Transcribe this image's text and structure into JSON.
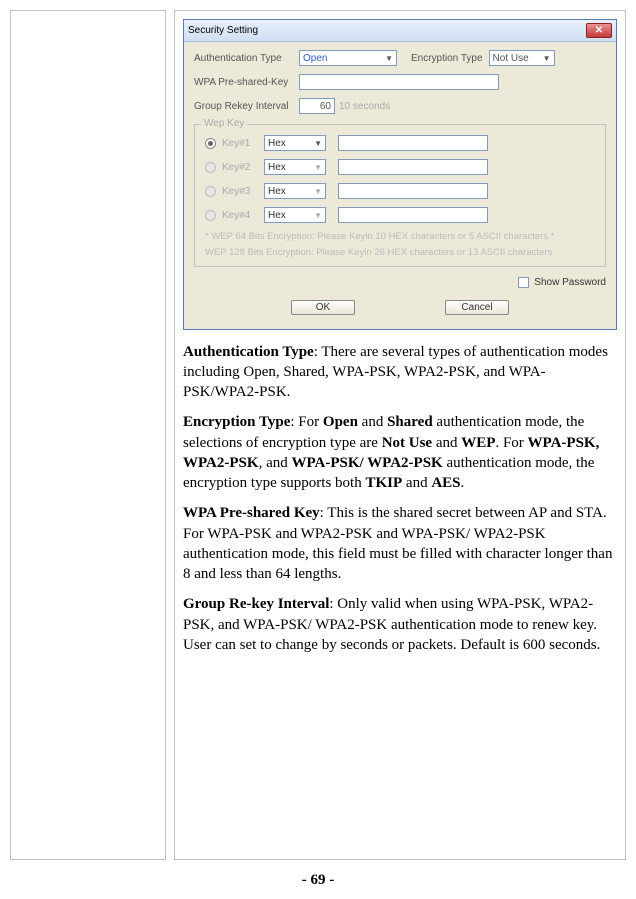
{
  "dialog": {
    "title": "Security Setting",
    "close_glyph": "✕",
    "auth_label": "Authentication Type",
    "auth_value": "Open",
    "enc_label": "Encryption Type",
    "enc_value": "Not Use",
    "psk_label": "WPA Pre-shared-Key",
    "interval_label": "Group Rekey Interval",
    "interval_value": "60",
    "interval_unit": "10 seconds",
    "wep_legend": "Wep Key",
    "keys": [
      {
        "label": "Key#1",
        "format": "Hex",
        "selected": true
      },
      {
        "label": "Key#2",
        "format": "Hex",
        "selected": false
      },
      {
        "label": "Key#3",
        "format": "Hex",
        "selected": false
      },
      {
        "label": "Key#4",
        "format": "Hex",
        "selected": false
      }
    ],
    "hint1": "* WEP 64 Bits Encryption:  Please Keyin 10 HEX characters or 5 ASCII characters *",
    "hint2": "WEP 128 Bits Encryption:  Please Keyin 26 HEX characters or 13 ASCII characters",
    "show_pw": "Show Password",
    "ok": "OK",
    "cancel": "Cancel"
  },
  "text": {
    "p1_b": "Authentication Type",
    "p1": ": There are several types of authentication modes including Open, Shared, WPA-PSK, WPA2-PSK, and WPA-PSK/WPA2-PSK.",
    "p2_b1": "Encryption Type",
    "p2_a": ": For ",
    "p2_b2": "Open",
    "p2_b": " and ",
    "p2_b3": "Shared",
    "p2_c": " authentication mode, the selections of encryption type are ",
    "p2_b4": "Not Use",
    "p2_d": " and ",
    "p2_b5": "WEP",
    "p2_e": ". For ",
    "p2_b6": "WPA-PSK, WPA2-PSK",
    "p2_f": ", and ",
    "p2_b7": "WPA-PSK/ WPA2-PSK",
    "p2_g": " authentication mode, the encryption type supports both ",
    "p2_b8": "TKIP",
    "p2_h": " and ",
    "p2_b9": "AES",
    "p2_i": ".",
    "p3_b": "WPA Pre-shared Key",
    "p3": ": This is the shared secret between AP and STA. For WPA-PSK and WPA2-PSK and WPA-PSK/ WPA2-PSK authentication mode, this field must be filled with character longer than 8 and less than 64 lengths.",
    "p4_b": "Group Re-key Interval",
    "p4": ": Only valid when using WPA-PSK, WPA2-PSK, and WPA-PSK/ WPA2-PSK authentication mode to renew key. User can set to change by seconds or packets. Default is 600 seconds."
  },
  "page_num": "- 69 -"
}
